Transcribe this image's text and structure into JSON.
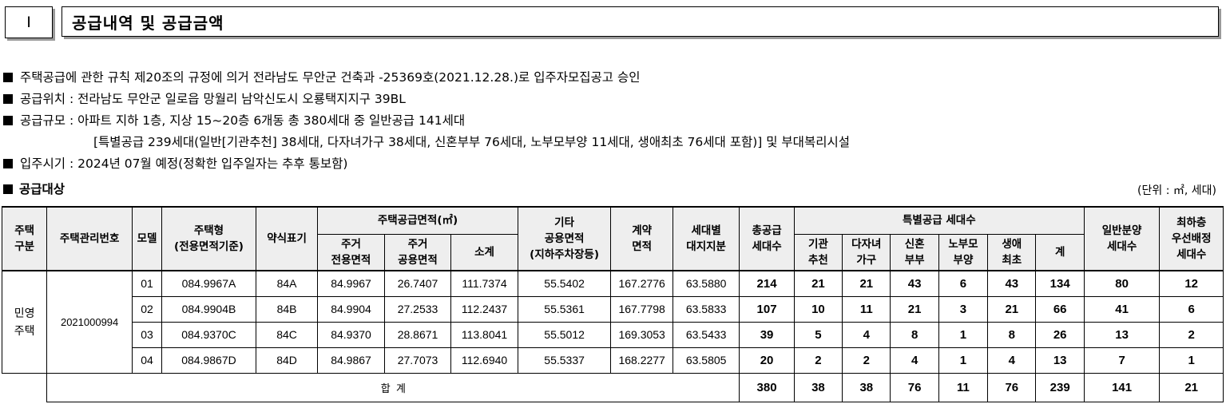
{
  "section": {
    "number": "Ⅰ",
    "title": "공급내역 및 공급금액"
  },
  "bullets": [
    "주택공급에 관한 규칙 제20조의 규정에 의거 전라남도 무안군 건축과 -25369호(2021.12.28.)로 입주자모집공고 승인",
    "공급위치 : 전라남도 무안군 일로읍 망월리 남악신도시 오룡택지지구 39BL",
    "공급규모 : 아파트 지하 1층, 지상 15~20층 6개동 총 380세대 중 일반공급 141세대",
    "[특별공급 239세대(일반[기관추천] 38세대, 다자녀가구 38세대, 신혼부부 76세대, 노부모부양 11세대, 생애최초 76세대 포함)] 및 부대복리시설",
    "입주시기 : 2024년 07월 예정(정확한 입주일자는 추후 통보함)"
  ],
  "subheading": "공급대상",
  "unit_note": "(단위 : ㎡, 세대)",
  "table": {
    "headers": {
      "housing_type_1": "주택",
      "housing_type_2": "구분",
      "mgmt_no": "주택관리번호",
      "model": "모델",
      "type_1": "주택형",
      "type_2": "(전용면적기준)",
      "short": "약식표기",
      "supply_area": "주택공급면적(㎡)",
      "res_excl_1": "주거",
      "res_excl_2": "전용면적",
      "res_common_1": "주거",
      "res_common_2": "공용면적",
      "subtotal": "소계",
      "other_1": "기타",
      "other_2": "공용면적",
      "other_3": "(지하주차장등)",
      "contract_1": "계약",
      "contract_2": "면적",
      "land_1": "세대별",
      "land_2": "대지지분",
      "total_supply_1": "총공급",
      "total_supply_2": "세대수",
      "special": "특별공급 세대수",
      "sp_inst_1": "기관",
      "sp_inst_2": "추천",
      "sp_multi_1": "다자녀",
      "sp_multi_2": "가구",
      "sp_newly_1": "신혼",
      "sp_newly_2": "부부",
      "sp_parent_1": "노부모",
      "sp_parent_2": "부양",
      "sp_first_1": "생애",
      "sp_first_2": "최초",
      "sp_sum": "계",
      "general_1": "일반분양",
      "general_2": "세대수",
      "lowest_1": "최하층",
      "lowest_2": "우선배정",
      "lowest_3": "세대수"
    },
    "housing_type": "민영\n주택",
    "mgmt_number": "2021000994",
    "rows": [
      {
        "model": "01",
        "type": "084.9967A",
        "short": "84A",
        "excl": "84.9967",
        "common": "26.7407",
        "subtotal": "111.7374",
        "other": "55.5402",
        "contract": "167.2776",
        "land": "63.5880",
        "total": "214",
        "inst": "21",
        "multi": "21",
        "newly": "43",
        "parent": "6",
        "first": "43",
        "sp_sum": "134",
        "general": "80",
        "lowest": "12"
      },
      {
        "model": "02",
        "type": "084.9904B",
        "short": "84B",
        "excl": "84.9904",
        "common": "27.2533",
        "subtotal": "112.2437",
        "other": "55.5361",
        "contract": "167.7798",
        "land": "63.5833",
        "total": "107",
        "inst": "10",
        "multi": "11",
        "newly": "21",
        "parent": "3",
        "first": "21",
        "sp_sum": "66",
        "general": "41",
        "lowest": "6"
      },
      {
        "model": "03",
        "type": "084.9370C",
        "short": "84C",
        "excl": "84.9370",
        "common": "28.8671",
        "subtotal": "113.8041",
        "other": "55.5012",
        "contract": "169.3053",
        "land": "63.5433",
        "total": "39",
        "inst": "5",
        "multi": "4",
        "newly": "8",
        "parent": "1",
        "first": "8",
        "sp_sum": "26",
        "general": "13",
        "lowest": "2"
      },
      {
        "model": "04",
        "type": "084.9867D",
        "short": "84D",
        "excl": "84.9867",
        "common": "27.7073",
        "subtotal": "112.6940",
        "other": "55.5337",
        "contract": "168.2277",
        "land": "63.5805",
        "total": "20",
        "inst": "2",
        "multi": "2",
        "newly": "4",
        "parent": "1",
        "first": "4",
        "sp_sum": "13",
        "general": "7",
        "lowest": "1"
      }
    ],
    "total_row": {
      "label": "합  계",
      "total": "380",
      "inst": "38",
      "multi": "38",
      "newly": "76",
      "parent": "11",
      "first": "76",
      "sp_sum": "239",
      "general": "141",
      "lowest": "21"
    }
  }
}
